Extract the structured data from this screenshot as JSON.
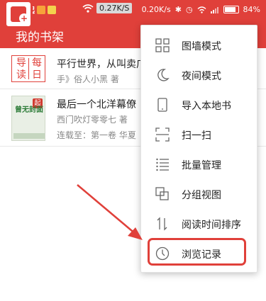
{
  "status_bar": {
    "net_speed": "0.27K/S",
    "right_speed": "0.20K/s",
    "battery_percent": "84%",
    "battery_level": 0.84,
    "left_badge": "起"
  },
  "header": {
    "title": "我的书架"
  },
  "books": [
    {
      "badge_chars": [
        "导读",
        "每日"
      ],
      "title": "平行世界，从叫卖广",
      "meta": "手》俗人小黑 著"
    },
    {
      "cover_tag": "起",
      "cover_text": "曾无封面",
      "title": "最后一个北洋幕僚",
      "author": "西门吹灯零零七 著",
      "progress": "连载至：第一卷 华夏"
    }
  ],
  "menu": {
    "items": [
      {
        "label": "图墙模式",
        "icon": "grid-icon"
      },
      {
        "label": "夜间模式",
        "icon": "moon-icon"
      },
      {
        "label": "导入本地书",
        "icon": "phone-icon"
      },
      {
        "label": "扫一扫",
        "icon": "scan-icon"
      },
      {
        "label": "批量管理",
        "icon": "list-icon"
      },
      {
        "label": "分组视图",
        "icon": "group-icon"
      },
      {
        "label": "阅读时间排序",
        "icon": "sort-icon"
      },
      {
        "label": "浏览记录",
        "icon": "clock-icon"
      }
    ]
  },
  "colors": {
    "accent": "#e0403a",
    "highlight_border": "#e0403a",
    "arrow": "#e0403a"
  }
}
